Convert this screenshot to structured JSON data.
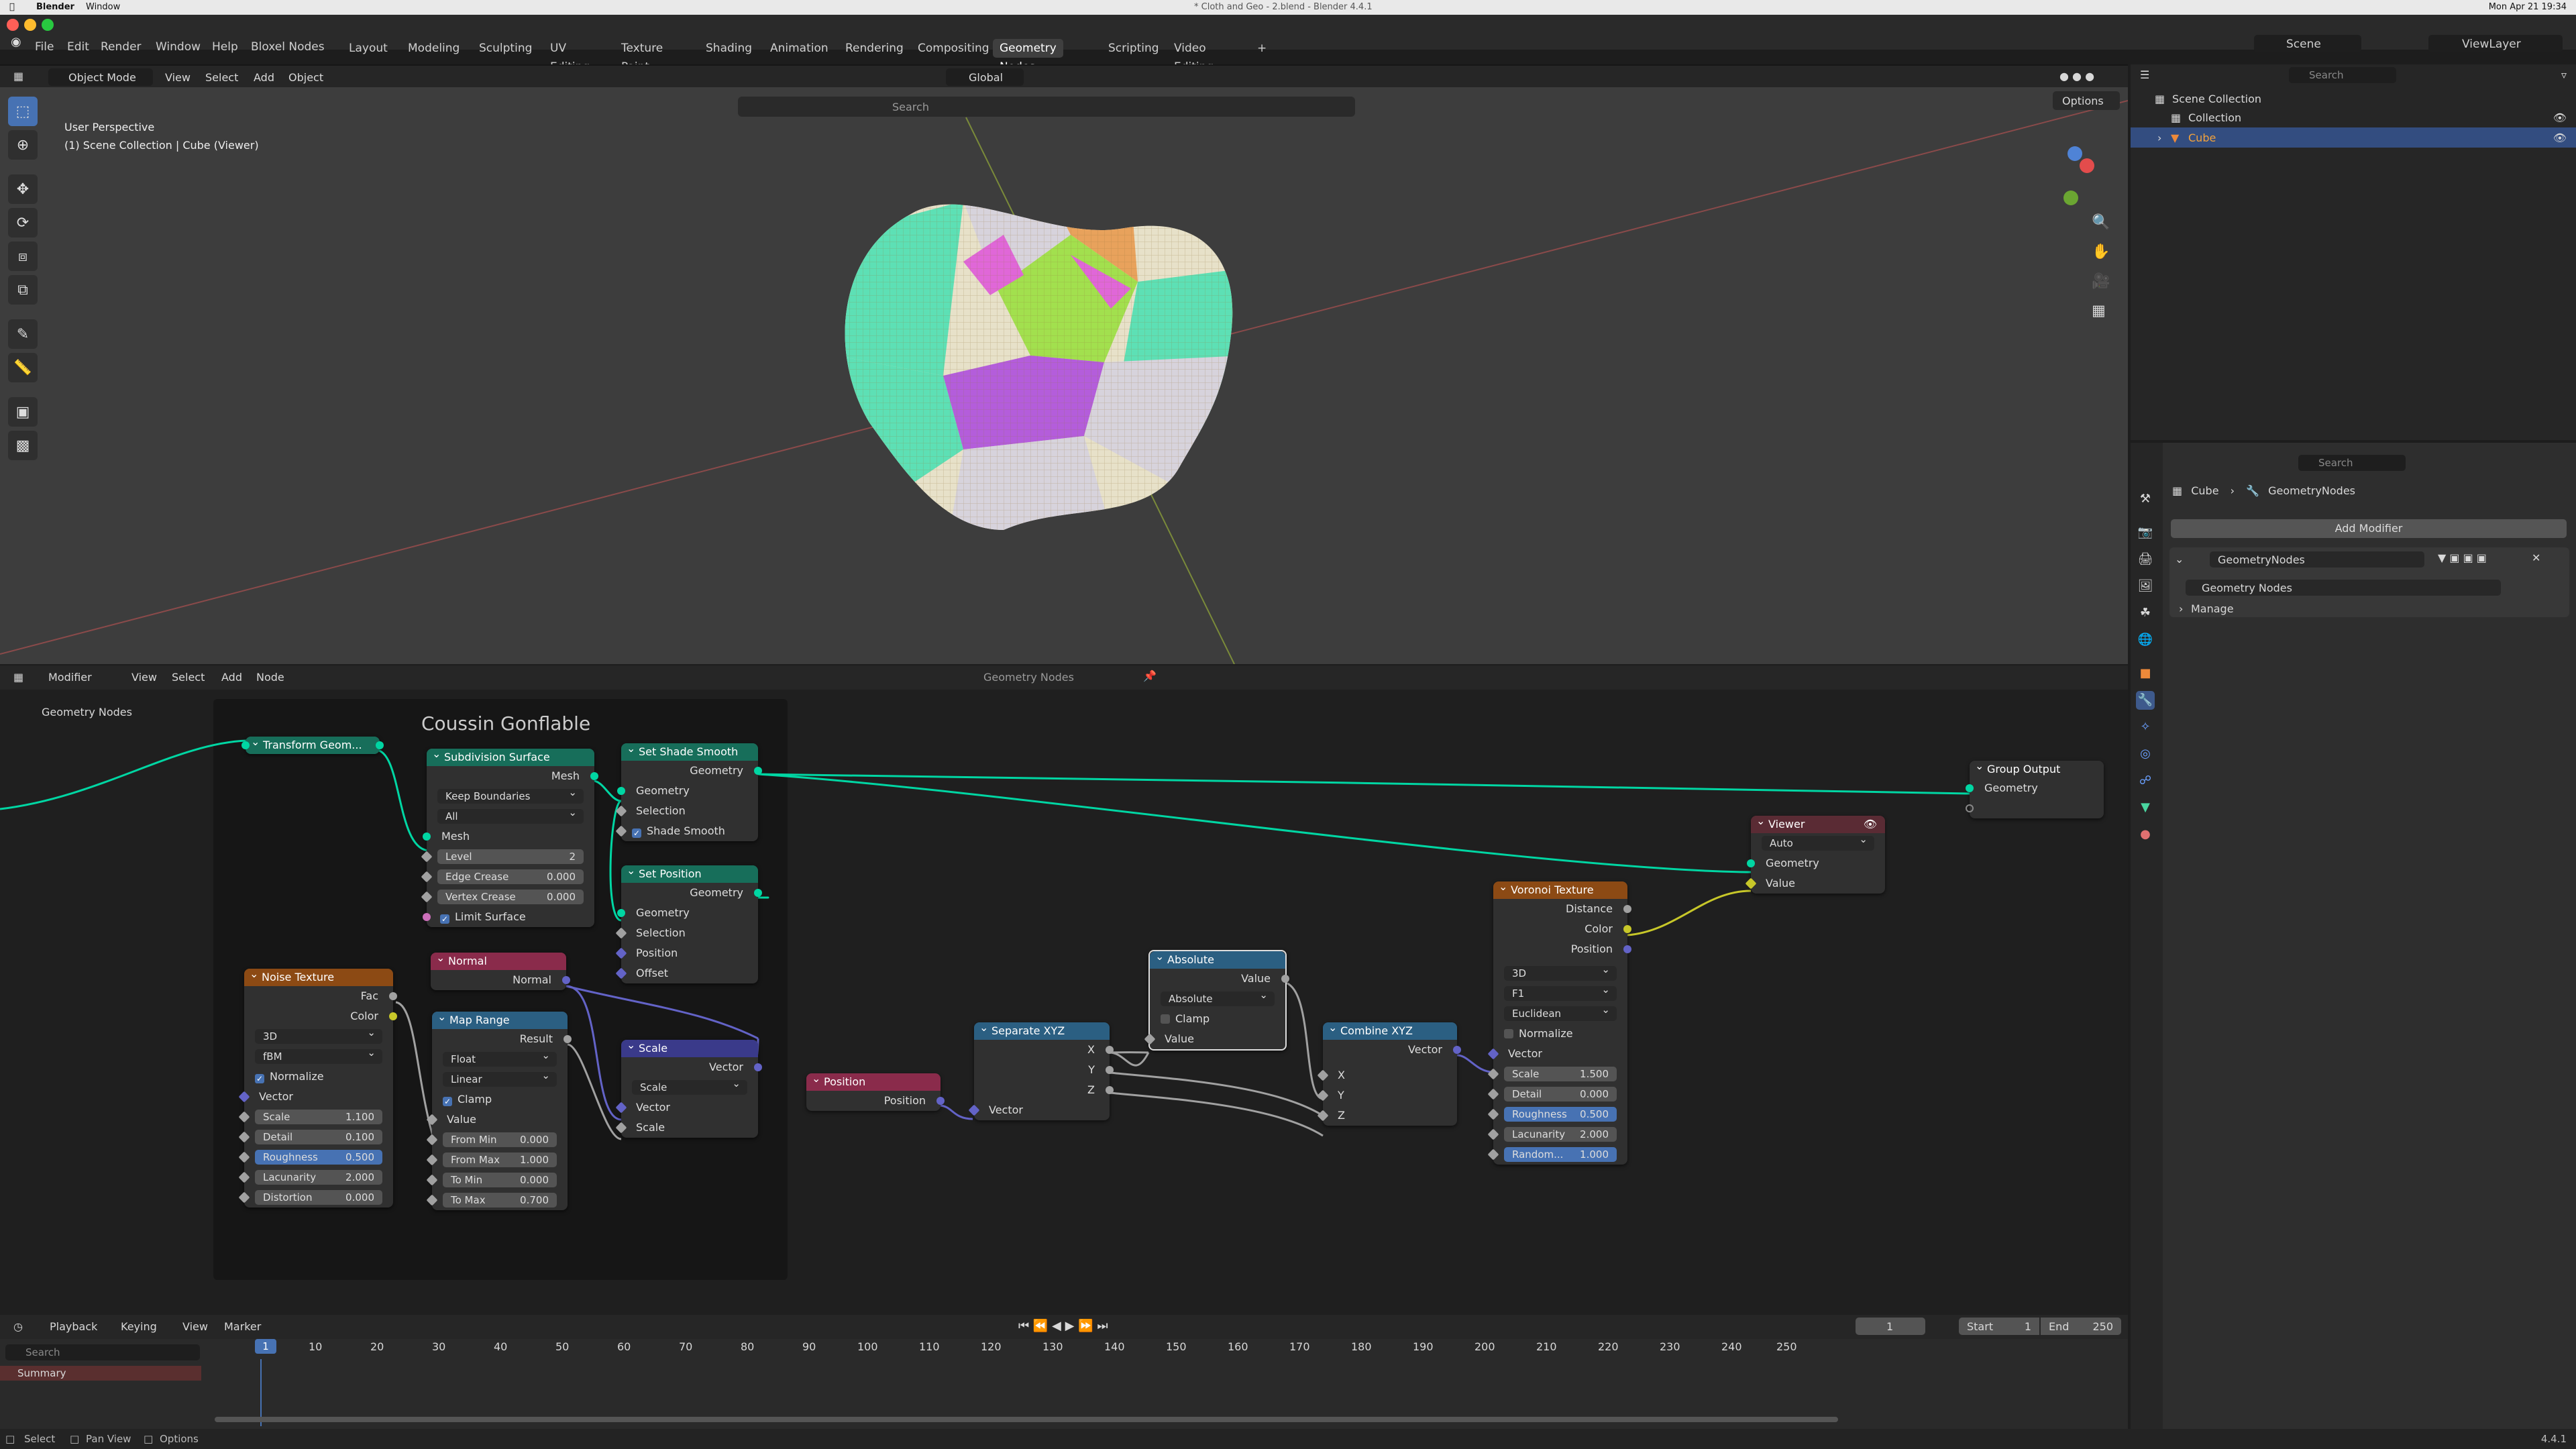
{
  "menubar": {
    "apple": "",
    "app": "Blender",
    "window": "Window",
    "title": "* Cloth and Geo - 2.blend - Blender 4.4.1",
    "datetime": "Mon Apr 21 19:34"
  },
  "topbar": {
    "menus": [
      "File",
      "Edit",
      "Render",
      "Window",
      "Help",
      "Bloxel Nodes"
    ],
    "workspaces": [
      "Layout",
      "Modeling",
      "Sculpting",
      "UV Editing",
      "Texture Paint",
      "Shading",
      "Animation",
      "Rendering",
      "Compositing",
      "Geometry Nodes",
      "Scripting",
      "Video Editing"
    ],
    "active_workspace": "Geometry Nodes",
    "add_tab": "+",
    "scene": "Scene",
    "viewlayer": "ViewLayer"
  },
  "viewport": {
    "mode": "Object Mode",
    "menus": [
      "View",
      "Select",
      "Add",
      "Object"
    ],
    "orientation": "Global",
    "search_placeholder": "Search",
    "options": "Options",
    "info_line1": "User Perspective",
    "info_line2": "(1) Scene Collection | Cube (Viewer)"
  },
  "outliner": {
    "search_placeholder": "Search",
    "items": [
      "Scene Collection",
      "Collection",
      "Cube"
    ]
  },
  "properties": {
    "search_placeholder": "Search",
    "breadcrumb_obj": "Cube",
    "breadcrumb_mod": "GeometryNodes",
    "add_modifier": "Add Modifier",
    "modifier_name": "GeometryNodes",
    "nodegroup": "Geometry Nodes",
    "manage": "Manage"
  },
  "node_editor": {
    "editor_type": "Modifier",
    "menus": [
      "View",
      "Select",
      "Add",
      "Node"
    ],
    "tree_name": "Geometry Nodes",
    "breadcrumb": "Geometry Nodes",
    "frame_label": "Coussin Gonflable"
  },
  "nodes": {
    "transform": {
      "title": "Transform Geom..."
    },
    "subdiv": {
      "title": "Subdivision Surface",
      "out": "Mesh",
      "sel1": "Keep Boundaries",
      "sel2": "All",
      "in_mesh": "Mesh",
      "level_l": "Level",
      "level_v": "2",
      "edge_l": "Edge Crease",
      "edge_v": "0.000",
      "vert_l": "Vertex Crease",
      "vert_v": "0.000",
      "limit": "Limit Surface"
    },
    "shade": {
      "title": "Set Shade Smooth",
      "out": "Geometry",
      "geo": "Geometry",
      "sel": "Selection",
      "smooth": "Shade Smooth"
    },
    "setpos": {
      "title": "Set Position",
      "out": "Geometry",
      "geo": "Geometry",
      "sel": "Selection",
      "pos": "Position",
      "off": "Offset"
    },
    "noise": {
      "title": "Noise Texture",
      "fac": "Fac",
      "color": "Color",
      "dim": "3D",
      "type": "fBM",
      "normalize": "Normalize",
      "vector": "Vector",
      "scale_l": "Scale",
      "scale_v": "1.100",
      "detail_l": "Detail",
      "detail_v": "0.100",
      "rough_l": "Roughness",
      "rough_v": "0.500",
      "lac_l": "Lacunarity",
      "lac_v": "2.000",
      "dist_l": "Distortion",
      "dist_v": "0.000"
    },
    "normal": {
      "title": "Normal",
      "out": "Normal"
    },
    "maprange": {
      "title": "Map Range",
      "out": "Result",
      "type": "Float",
      "interp": "Linear",
      "clamp": "Clamp",
      "value": "Value",
      "fmin_l": "From Min",
      "fmin_v": "0.000",
      "fmax_l": "From Max",
      "fmax_v": "1.000",
      "tmin_l": "To Min",
      "tmin_v": "0.000",
      "tmax_l": "To Max",
      "tmax_v": "0.700"
    },
    "scale": {
      "title": "Scale",
      "out": "Vector",
      "op": "Scale",
      "vector": "Vector",
      "scale": "Scale"
    },
    "position": {
      "title": "Position",
      "out": "Position"
    },
    "separate": {
      "title": "Separate XYZ",
      "x": "X",
      "y": "Y",
      "z": "Z",
      "vector": "Vector"
    },
    "absolute": {
      "title": "Absolute",
      "out": "Value",
      "op": "Absolute",
      "clamp": "Clamp",
      "value": "Value"
    },
    "combine": {
      "title": "Combine XYZ",
      "out": "Vector",
      "x": "X",
      "y": "Y",
      "z": "Z"
    },
    "voronoi": {
      "title": "Voronoi Texture",
      "dist": "Distance",
      "color": "Color",
      "pos": "Position",
      "dim": "3D",
      "feat": "F1",
      "metric": "Euclidean",
      "normalize": "Normalize",
      "vector": "Vector",
      "scale_l": "Scale",
      "scale_v": "1.500",
      "detail_l": "Detail",
      "detail_v": "0.000",
      "rough_l": "Roughness",
      "rough_v": "0.500",
      "lac_l": "Lacunarity",
      "lac_v": "2.000",
      "rand_l": "Random...",
      "rand_v": "1.000"
    },
    "viewer": {
      "title": "Viewer",
      "domain": "Auto",
      "geo": "Geometry",
      "value": "Value"
    },
    "groupout": {
      "title": "Group Output",
      "geo": "Geometry"
    }
  },
  "timeline": {
    "menus": [
      "Playback",
      "Keying",
      "View",
      "Marker"
    ],
    "current": "1",
    "start_l": "Start",
    "start_v": "1",
    "end_l": "End",
    "end_v": "250",
    "ticks": [
      "1",
      "10",
      "20",
      "30",
      "40",
      "50",
      "60",
      "70",
      "80",
      "90",
      "100",
      "110",
      "120",
      "130",
      "140",
      "150",
      "160",
      "170",
      "180",
      "190",
      "200",
      "210",
      "220",
      "230",
      "240",
      "250"
    ],
    "search_placeholder": "Search",
    "summary": "Summary"
  },
  "statusbar": {
    "select": "Select",
    "pan": "Pan View",
    "options": "Options",
    "version": "4.4.1"
  },
  "colors": {
    "geometry_socket": "#00d6a3",
    "vector_socket": "#6363c7",
    "color_socket": "#c7c729",
    "float_socket": "#a1a1a1",
    "accent": "#4772b3"
  }
}
